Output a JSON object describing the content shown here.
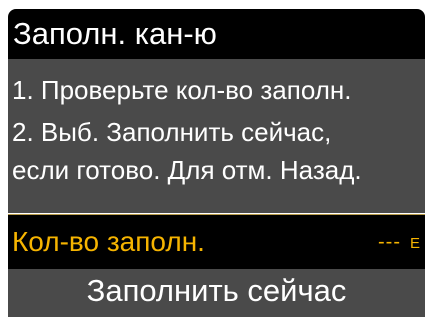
{
  "header": {
    "title": "Заполн. кан-ю"
  },
  "instructions": {
    "line_1": "1. Проверьте кол-во заполн.",
    "line_2": "2. Выб. Заполнить сейчас,",
    "line_3": "если готово. Для отм. Назад."
  },
  "fill_amount": {
    "label": "Кол-во заполн.",
    "value": "---",
    "unit": "Е"
  },
  "actions": {
    "fill_now_label": "Заполнить сейчас"
  },
  "colors": {
    "header_background": "#000000",
    "panel_background": "#4a4a4a",
    "text_primary": "#ffffff",
    "highlight_text": "#f6b400",
    "highlight_border": "#b89c4a"
  }
}
